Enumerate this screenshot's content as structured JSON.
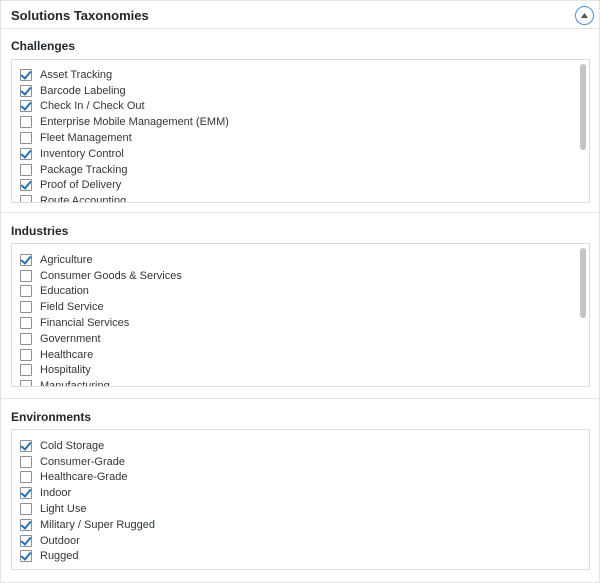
{
  "panel": {
    "title": "Solutions Taxonomies",
    "toggle_icon": "collapse-up-icon"
  },
  "sections": [
    {
      "title": "Challenges",
      "items": [
        {
          "label": "Asset Tracking",
          "checked": true
        },
        {
          "label": "Barcode Labeling",
          "checked": true
        },
        {
          "label": "Check In / Check Out",
          "checked": true
        },
        {
          "label": "Enterprise Mobile Management (EMM)",
          "checked": false
        },
        {
          "label": "Fleet Management",
          "checked": false
        },
        {
          "label": "Inventory Control",
          "checked": true
        },
        {
          "label": "Package Tracking",
          "checked": false
        },
        {
          "label": "Proof of Delivery",
          "checked": true
        },
        {
          "label": "Route Accounting",
          "checked": false
        }
      ]
    },
    {
      "title": "Industries",
      "items": [
        {
          "label": "Agriculture",
          "checked": true
        },
        {
          "label": "Consumer Goods & Services",
          "checked": false
        },
        {
          "label": "Education",
          "checked": false
        },
        {
          "label": "Field Service",
          "checked": false
        },
        {
          "label": "Financial Services",
          "checked": false
        },
        {
          "label": "Government",
          "checked": false
        },
        {
          "label": "Healthcare",
          "checked": false
        },
        {
          "label": "Hospitality",
          "checked": false
        },
        {
          "label": "Manufacturing",
          "checked": false
        }
      ]
    },
    {
      "title": "Environments",
      "items": [
        {
          "label": "Cold Storage",
          "checked": true
        },
        {
          "label": "Consumer-Grade",
          "checked": false
        },
        {
          "label": "Healthcare-Grade",
          "checked": false
        },
        {
          "label": "Indoor",
          "checked": true
        },
        {
          "label": "Light Use",
          "checked": false
        },
        {
          "label": "Military / Super Rugged",
          "checked": true
        },
        {
          "label": "Outdoor",
          "checked": true
        },
        {
          "label": "Rugged",
          "checked": true
        }
      ]
    }
  ]
}
